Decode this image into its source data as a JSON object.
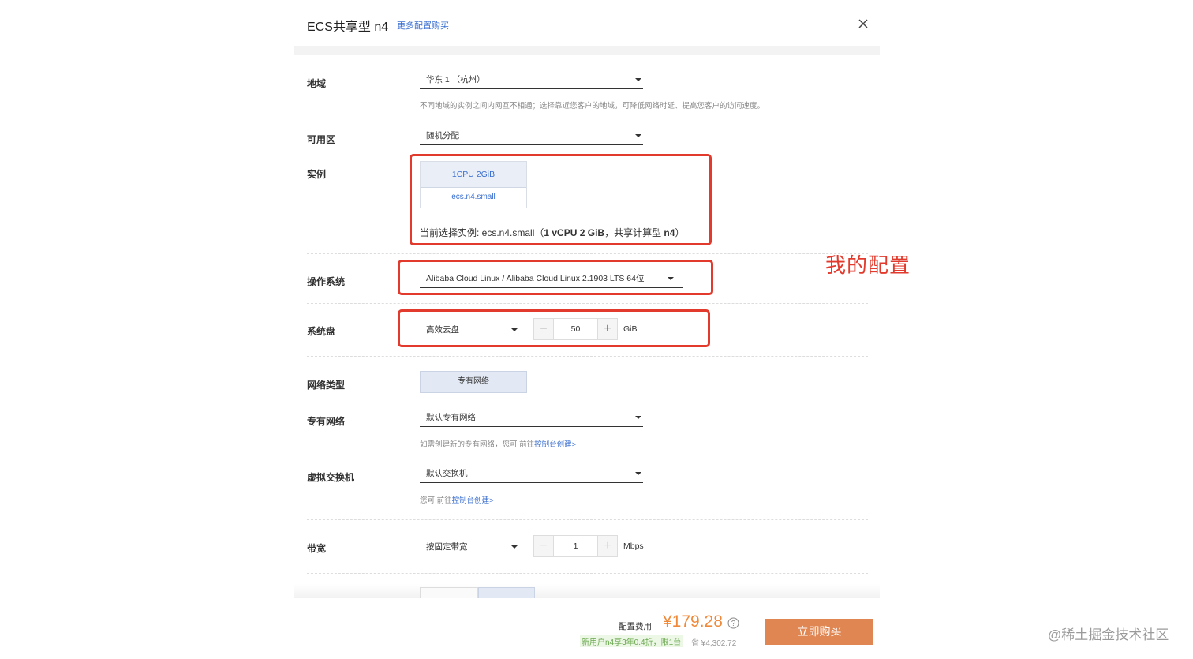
{
  "header": {
    "title": "ECS共享型 n4",
    "more_link": "更多配置购买"
  },
  "fields": {
    "region": {
      "label": "地域",
      "value": "华东 1 （杭州）",
      "hint": "不同地域的实例之间内网互不相通；选择靠近您客户的地域，可降低网络时延、提高您客户的访问速度。"
    },
    "zone": {
      "label": "可用区",
      "value": "随机分配"
    },
    "instance": {
      "label": "实例",
      "card_spec": "1CPU 2GiB",
      "card_type": "ecs.n4.small",
      "current_prefix": "当前选择实例: ecs.n4.small（",
      "current_bold": "1 vCPU 2 GiB",
      "current_mid": "，共享计算型 ",
      "current_bold2": "n4",
      "current_suffix": "）"
    },
    "os": {
      "label": "操作系统",
      "value": "Alibaba Cloud Linux / Alibaba Cloud Linux 2.1903 LTS 64位"
    },
    "disk": {
      "label": "系统盘",
      "type": "高效云盘",
      "size": "50",
      "unit": "GiB"
    },
    "network_type": {
      "label": "网络类型",
      "option": "专有网络"
    },
    "vpc": {
      "label": "专有网络",
      "value": "默认专有网络",
      "hint_prefix": "如需创建新的专有网络，您可 前往",
      "hint_link": "控制台创建>"
    },
    "vswitch": {
      "label": "虚拟交换机",
      "value": "默认交换机",
      "hint_prefix": "您可 前往",
      "hint_link": "控制台创建>"
    },
    "bandwidth": {
      "label": "带宽",
      "mode": "按固定带宽",
      "value": "1",
      "unit": "Mbps"
    }
  },
  "annotation": "我的配置",
  "footer": {
    "price_label": "配置费用",
    "price": "¥179.28",
    "promo": "新用户n4享3年0.4折，限1台",
    "save": "省 ¥4,302.72",
    "buy_button": "立即购买"
  },
  "watermark": "@稀土掘金技术社区",
  "colors": {
    "accent": "#3a6fd0",
    "price": "#f08a3a",
    "buy_button": "#e08652",
    "highlight_box": "#e23a2c",
    "promo": "#6aa84f"
  },
  "icons": [
    "close-icon",
    "chevron-down-icon",
    "minus-icon",
    "plus-icon",
    "help-icon"
  ]
}
